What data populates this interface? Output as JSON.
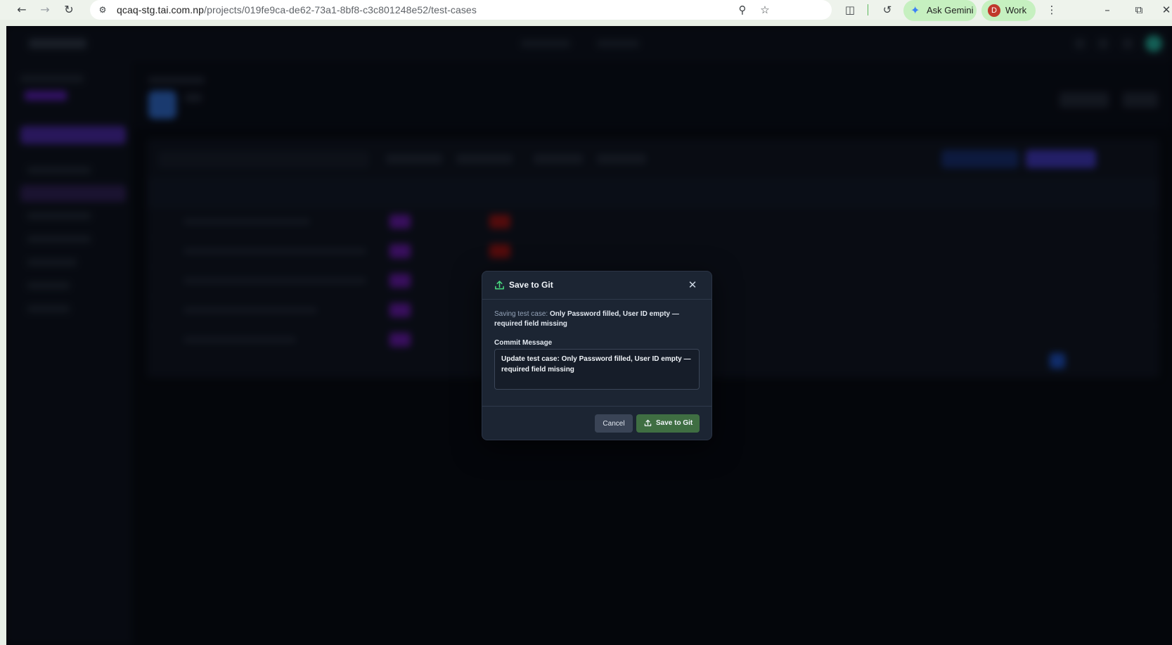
{
  "browser": {
    "url_host": "qcaq-stg.tai.com.np",
    "url_path": "/projects/019fe9ca-de62-73a1-8bf8-c3c801248e52/test-cases",
    "gemini_label": "Ask Gemini",
    "profile_initial": "D",
    "profile_label": "Work",
    "icons": [
      "back-icon",
      "forward-icon",
      "reload-icon",
      "site-info-icon",
      "zoom-icon",
      "bookmark-star-icon",
      "extensions-icon",
      "sync-icon",
      "gemini-icon",
      "menu-icon",
      "minimize-icon",
      "restore-icon",
      "close-icon"
    ]
  },
  "modal": {
    "title": "Save to Git",
    "saving_prefix": "Saving test case: ",
    "test_case_name": "Only Password filled, User ID empty — required field missing",
    "commit_label": "Commit Message",
    "commit_message": "Update test case: Only Password filled, User ID empty — required field missing",
    "cancel_label": "Cancel",
    "save_label": "Save to Git",
    "colors": {
      "accent_green": "#3f6e42",
      "icon_green": "#4ade80",
      "background": "#1c2533"
    }
  }
}
